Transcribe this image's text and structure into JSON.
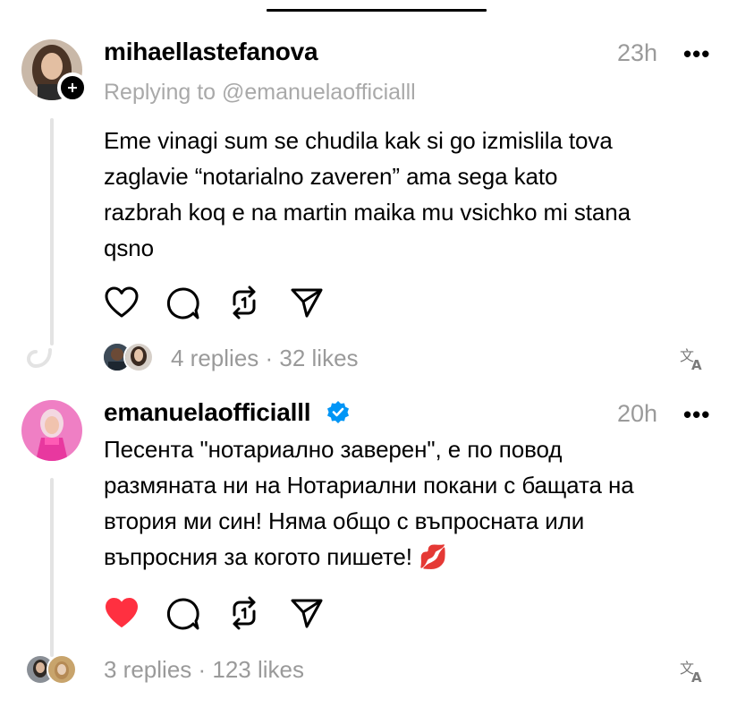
{
  "comments": [
    {
      "username": "mihaellastefanova",
      "time": "23h",
      "more": "•••",
      "replying_to": "Replying to @emanuelaofficialll",
      "body": "Eme vinagi sum se chudila kak si go izmislila tova\nzaglavie “notarialno zaveren” ama sega kato\nrazbrah koq e na martin maika mu vsichko mi stana\nqsno",
      "liked": false,
      "stats": "4 replies · 32 likes"
    },
    {
      "username": "emanuelaofficialll",
      "verified": true,
      "time": "20h",
      "more": "•••",
      "body": "Песента \"нотариално заверен\", е по повод\nразмяната ни на Нотариални покани с бащата на\nвтория ми син! Няма общо с въпросната или\nвъпросния за когото пишете! 💋",
      "liked": true,
      "stats": "3 replies · 123 likes"
    }
  ],
  "icons": {
    "like": "heart-icon",
    "reply": "comment-bubble-icon",
    "repost": "repost-icon",
    "share": "send-icon",
    "translate": "translate-icon",
    "more": "more-icon"
  },
  "colors": {
    "liked": "#ff3040",
    "verified": "#0095f6",
    "muted": "#9a9a9a"
  }
}
